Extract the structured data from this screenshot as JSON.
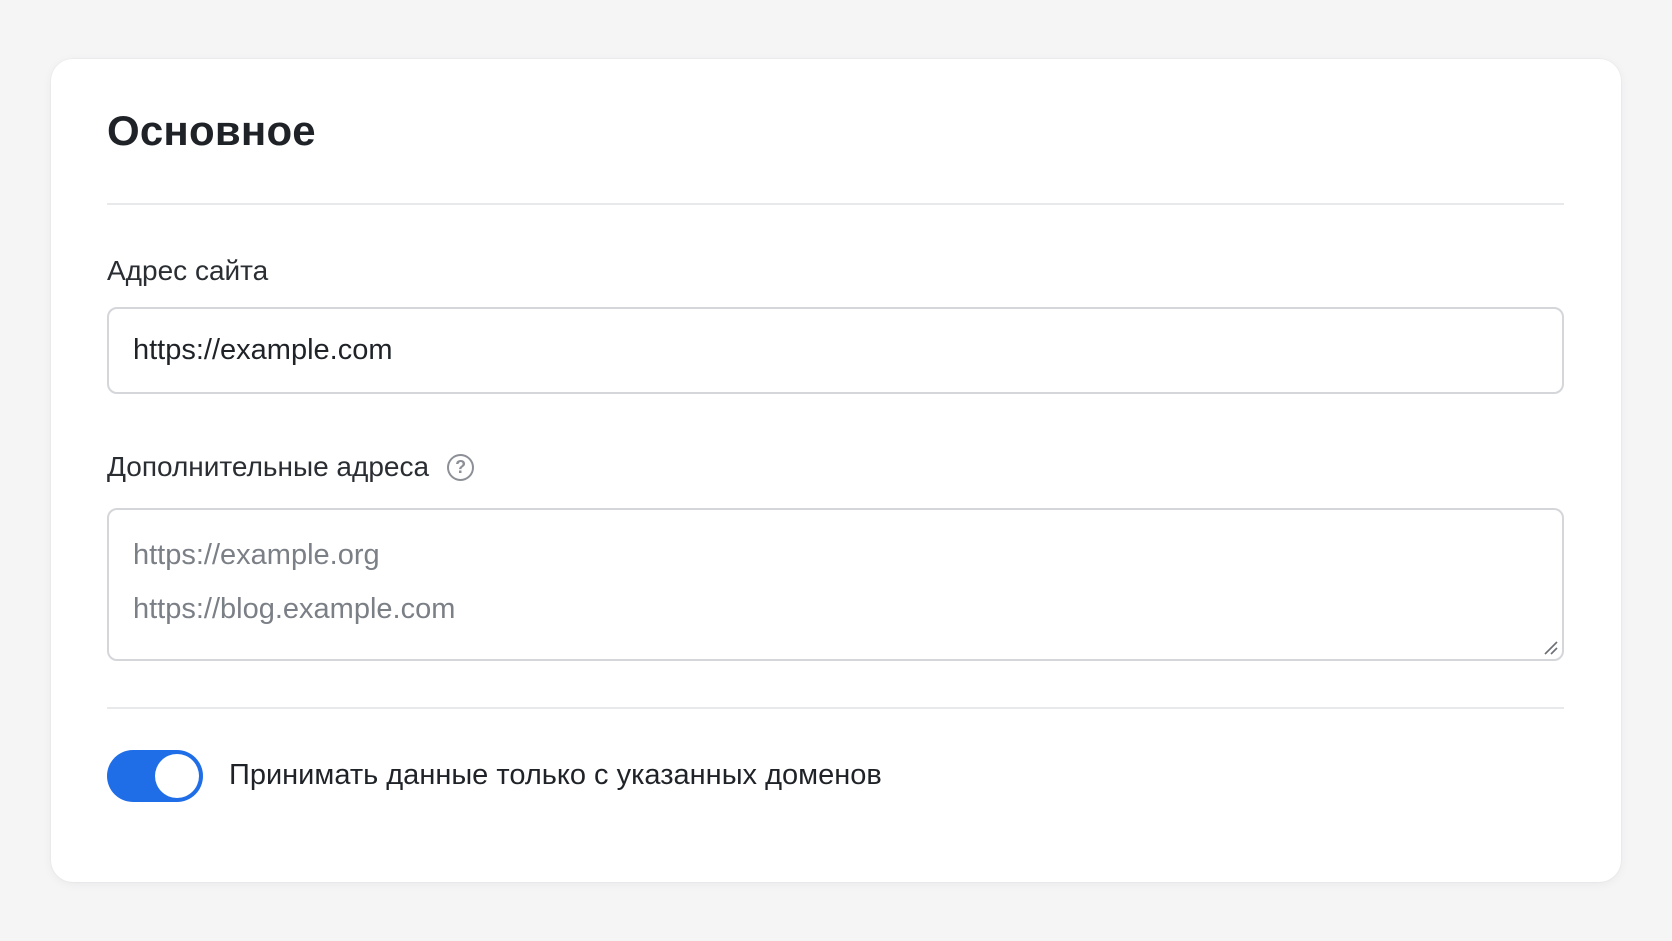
{
  "section": {
    "title": "Основное"
  },
  "site_address": {
    "label": "Адрес сайта",
    "value": "https://example.com"
  },
  "extra_addresses": {
    "label": "Дополнительные адреса",
    "help_icon": "?",
    "placeholder_lines": [
      "https://example.org",
      "https://blog.example.com"
    ]
  },
  "restrict_domains": {
    "label": "Принимать данные только с указанных доменов",
    "enabled": true
  },
  "colors": {
    "accent": "#1f6ee8",
    "background": "#f5f5f6",
    "card": "#ffffff",
    "border": "#d4d6da",
    "placeholder": "#7b7f86"
  }
}
